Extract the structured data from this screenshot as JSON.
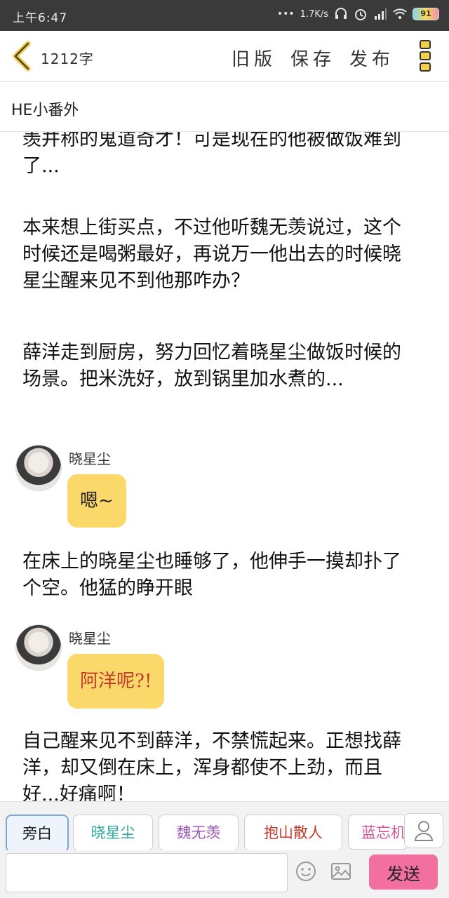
{
  "status_bar": {
    "time": "上午6:47",
    "net_speed": "1.7K/s",
    "battery": "91"
  },
  "toolbar": {
    "word_count": "1212字",
    "old_version": "旧版",
    "save": "保存",
    "publish": "发布"
  },
  "title": "HE小番外",
  "content": {
    "para1": "羡并称的鬼道奇才！可是现在的他被做饭难到了...",
    "para2": "本来想上街买点，不过他听魏无羡说过，这个时候还是喝粥最好，再说万一他出去的时候晓星尘醒来见不到他那咋办？",
    "para3": "薛洋走到厨房，努力回忆着晓星尘做饭时候的场景。把米洗好，放到锅里加水煮的...",
    "dialog1": {
      "speaker": "晓星尘",
      "text": "嗯~"
    },
    "para4": "在床上的晓星尘也睡够了，他伸手一摸却扑了个空。他猛的睁开眼",
    "dialog2": {
      "speaker": "晓星尘",
      "text": "阿洋呢?!"
    },
    "para5": "自己醒来见不到薛洋，不禁慌起来。正想找薛洋，却又倒在床上，浑身都使不上劲，而且好...好痛啊！"
  },
  "roles": [
    {
      "label": "旁白",
      "color": "#333333"
    },
    {
      "label": "晓星尘",
      "color": "#2aa89b"
    },
    {
      "label": "魏无羡",
      "color": "#9b59b6"
    },
    {
      "label": "抱山散人",
      "color": "#c0392b"
    },
    {
      "label": "蓝忘机",
      "color": "#d35496"
    }
  ],
  "input": {
    "placeholder": "",
    "send_label": "发送"
  }
}
